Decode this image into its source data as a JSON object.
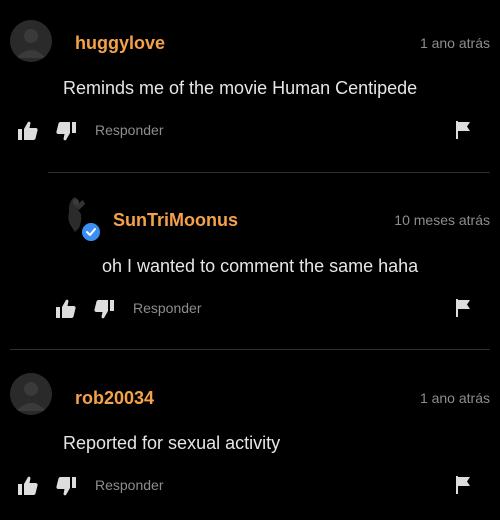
{
  "comments": [
    {
      "username": "huggylove",
      "timestamp": "1 ano atrás",
      "text": "Reminds me of the movie Human Centipede",
      "reply_label": "Responder"
    },
    {
      "username": "SunTriMoonus",
      "timestamp": "10 meses atrás",
      "text": "oh I wanted to comment the same haha",
      "reply_label": "Responder",
      "verified": true
    },
    {
      "username": "rob20034",
      "timestamp": "1 ano atrás",
      "text": "Reported for sexual activity",
      "reply_label": "Responder"
    }
  ],
  "colors": {
    "background": "#000000",
    "username": "#f5a14a",
    "muted": "#8d8d8d",
    "verified_badge": "#3b8ff3"
  },
  "icons": [
    "like-icon",
    "dislike-icon",
    "flag-icon",
    "verified-icon",
    "avatar-placeholder"
  ]
}
